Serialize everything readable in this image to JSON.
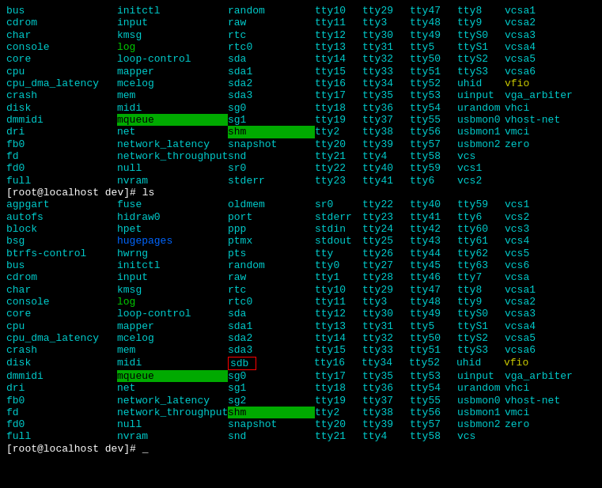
{
  "terminal": {
    "prompt1": "[root@localhost dev]# ls",
    "prompt2": "[root@localhost dev]# ls",
    "prompt3": "[root@localhost dev]# _"
  }
}
